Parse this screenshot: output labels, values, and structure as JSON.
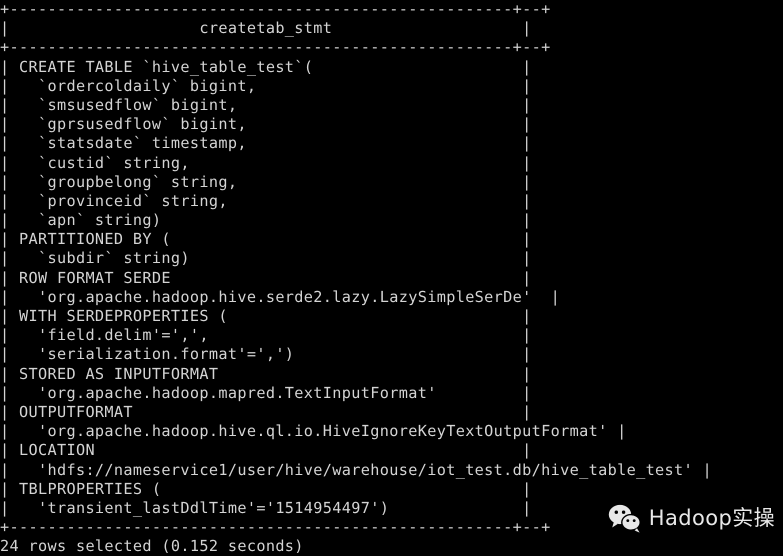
{
  "terminal": {
    "type": "sql-client-result-table",
    "background_color": "#000000",
    "text_color": "#d4d4d4",
    "column_header": "createtab_stmt",
    "top_rule": "+-----------------------------------------------------+--+",
    "header_rule": "+-----------------------------------------------------+--+",
    "bottom_rule": "+-----------------------------------------------------+--+",
    "rows": [
      "| CREATE TABLE `hive_table_test`(                      |",
      "|   `ordercoldaily` bigint,                            |",
      "|   `smsusedflow` bigint,                              |",
      "|   `gprsusedflow` bigint,                             |",
      "|   `statsdate` timestamp,                             |",
      "|   `custid` string,                                   |",
      "|   `groupbelong` string,                              |",
      "|   `provinceid` string,                               |",
      "|   `apn` string)                                      |",
      "| PARTITIONED BY (                                     |",
      "|   `subdir` string)                                   |",
      "| ROW FORMAT SERDE                                     |",
      "|   'org.apache.hadoop.hive.serde2.lazy.LazySimpleSerDe'  |",
      "| WITH SERDEPROPERTIES (                               |",
      "|   'field.delim'=',',                                 |",
      "|   'serialization.format'=',')                        |",
      "| STORED AS INPUTFORMAT                                |",
      "|   'org.apache.hadoop.mapred.TextInputFormat'         |",
      "| OUTPUTFORMAT                                         |",
      "|   'org.apache.hadoop.hive.ql.io.HiveIgnoreKeyTextOutputFormat' |",
      "| LOCATION                                             |",
      "|   'hdfs://nameservice1/user/hive/warehouse/iot_test.db/hive_table_test' |",
      "| TBLPROPERTIES (                                      |",
      "|   'transient_lastDdlTime'='1514954497')              |"
    ],
    "header_row": "|                    createtab_stmt                    |",
    "status_line": "24 rows selected (0.152 seconds)",
    "row_count": 24,
    "elapsed_seconds": "0.152"
  },
  "statement": {
    "command": "CREATE TABLE",
    "table_name": "hive_table_test",
    "columns": [
      {
        "name": "ordercoldaily",
        "type": "bigint"
      },
      {
        "name": "smsusedflow",
        "type": "bigint"
      },
      {
        "name": "gprsusedflow",
        "type": "bigint"
      },
      {
        "name": "statsdate",
        "type": "timestamp"
      },
      {
        "name": "custid",
        "type": "string"
      },
      {
        "name": "groupbelong",
        "type": "string"
      },
      {
        "name": "provinceid",
        "type": "string"
      },
      {
        "name": "apn",
        "type": "string"
      }
    ],
    "partitioned_by": [
      {
        "name": "subdir",
        "type": "string"
      }
    ],
    "row_format_serde": "org.apache.hadoop.hive.serde2.lazy.LazySimpleSerDe",
    "serde_properties": {
      "field.delim": ",",
      "serialization.format": ","
    },
    "input_format": "org.apache.hadoop.mapred.TextInputFormat",
    "output_format": "org.apache.hadoop.hive.ql.io.HiveIgnoreKeyTextOutputFormat",
    "location": "hdfs://nameservice1/user/hive/warehouse/iot_test.db/hive_table_test",
    "tbl_properties": {
      "transient_lastDdlTime": "1514954497"
    }
  },
  "watermark": {
    "icon": "wechat-icon",
    "label": "Hadoop实操",
    "color": "#e8e8e8"
  }
}
